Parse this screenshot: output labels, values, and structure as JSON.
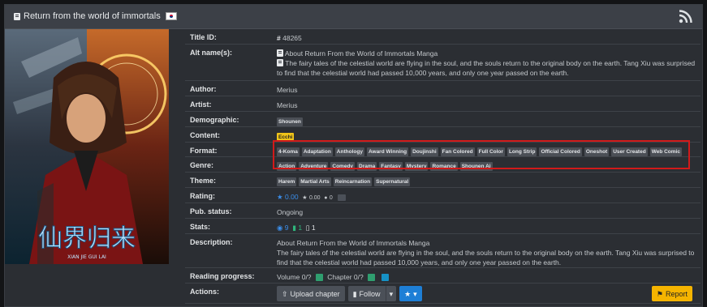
{
  "header": {
    "title": "Return from the world of immortals",
    "book_icon": "book-icon",
    "flag_icon": "korean-flag-icon",
    "rss_icon": "rss-icon"
  },
  "cover": {
    "title_art": "仙界归来",
    "subtitle_art": "XIAN JIE GUI LAI"
  },
  "rows": {
    "title_id": {
      "label": "Title ID:",
      "value": "48265"
    },
    "alt_names": {
      "label": "Alt name(s):",
      "names": [
        "About Return From the World of Immortals Manga",
        "The fairy tales of the celestial world are flying in the soul, and the souls return to the original body on the earth. Tang Xiu was surprised to find that the celestial world had passed 10,000 years, and only one year passed on the earth."
      ]
    },
    "author": {
      "label": "Author:",
      "value": "Merius"
    },
    "artist": {
      "label": "Artist:",
      "value": "Merius"
    },
    "demographic": {
      "label": "Demographic:",
      "tags": [
        "Shounen"
      ]
    },
    "content": {
      "label": "Content:",
      "tags": [
        "Ecchi"
      ]
    },
    "format": {
      "label": "Format:",
      "tags": [
        "4-Koma",
        "Adaptation",
        "Anthology",
        "Award Winning",
        "Doujinshi",
        "Fan Colored",
        "Full Color",
        "Long Strip",
        "Official Colored",
        "Oneshot",
        "User Created",
        "Web Comic"
      ]
    },
    "genre": {
      "label": "Genre:",
      "tags": [
        "Action",
        "Adventure",
        "Comedy",
        "Drama",
        "Fantasy",
        "Mystery",
        "Romance",
        "Shounen Ai"
      ]
    },
    "theme": {
      "label": "Theme:",
      "tags": [
        "Harem",
        "Martial Arts",
        "Reincarnation",
        "Supernatural"
      ]
    },
    "rating": {
      "label": "Rating:",
      "bayesian": "0.00",
      "mean": "0.00",
      "users": "0"
    },
    "pub_status": {
      "label": "Pub. status:",
      "value": "Ongoing"
    },
    "stats": {
      "label": "Stats:",
      "views": "9",
      "follows": "1",
      "comments": "1"
    },
    "description": {
      "label": "Description:",
      "line1": "About Return From the World of Immortals Manga",
      "line2": "The fairy tales of the celestial world are flying in the soul, and the souls return to the original body on the earth. Tang Xiu was surprised to find that the celestial world had passed 10,000 years, and only one year passed on the earth."
    },
    "reading_progress": {
      "label": "Reading progress:",
      "volume": "Volume 0/?",
      "chapter": "Chapter 0/?"
    },
    "actions": {
      "label": "Actions:",
      "upload": "Upload chapter",
      "follow": "Follow",
      "report": "Report"
    }
  },
  "colors": {
    "accent_blue": "#3b8eea",
    "green": "#2fb67c",
    "highlight": "#d11a1a",
    "report": "#f5b400",
    "ecchi": "#f0c419"
  }
}
